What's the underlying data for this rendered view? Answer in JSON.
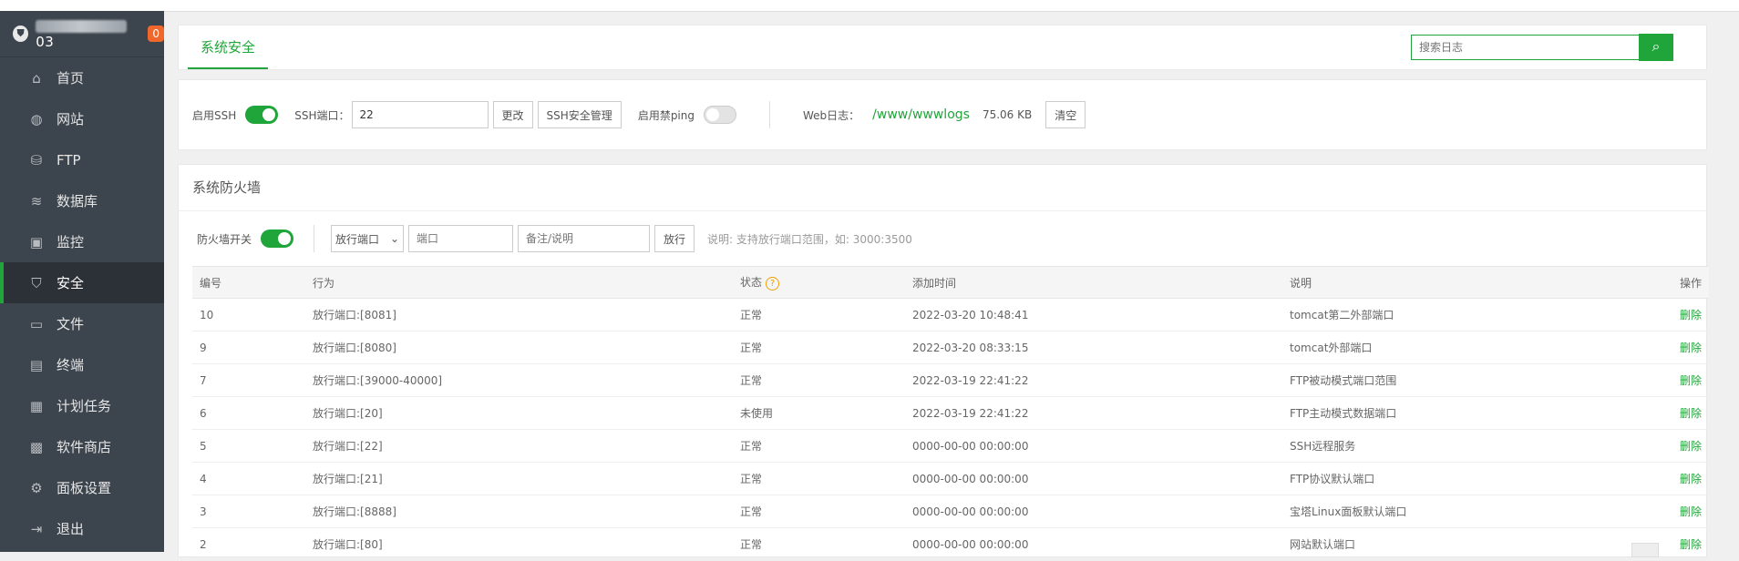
{
  "sidebar": {
    "host_suffix": "03",
    "badge": "0",
    "items": [
      {
        "label": "首页",
        "icon": "home-icon"
      },
      {
        "label": "网站",
        "icon": "globe-icon"
      },
      {
        "label": "FTP",
        "icon": "ftp-icon"
      },
      {
        "label": "数据库",
        "icon": "database-icon"
      },
      {
        "label": "监控",
        "icon": "monitor-icon"
      },
      {
        "label": "安全",
        "icon": "shield-icon",
        "active": true
      },
      {
        "label": "文件",
        "icon": "folder-icon"
      },
      {
        "label": "终端",
        "icon": "terminal-icon"
      },
      {
        "label": "计划任务",
        "icon": "calendar-icon"
      },
      {
        "label": "软件商店",
        "icon": "apps-icon"
      },
      {
        "label": "面板设置",
        "icon": "gear-icon"
      },
      {
        "label": "退出",
        "icon": "logout-icon"
      }
    ]
  },
  "header": {
    "tab": "系统安全",
    "search_placeholder": "搜索日志"
  },
  "settings": {
    "ssh_label": "启用SSH",
    "ssh_port_label": "SSH端口：",
    "ssh_port_value": "22",
    "change_btn": "更改",
    "ssh_manage_btn": "SSH安全管理",
    "ping_label": "启用禁ping",
    "weblog_label": "Web日志：",
    "weblog_path": "/www/wwwlogs",
    "weblog_size": "75.06 KB",
    "clear_btn": "清空"
  },
  "firewall": {
    "title": "系统防火墙",
    "switch_label": "防火墙开关",
    "select_value": "放行端口",
    "port_placeholder": "端口",
    "remark_placeholder": "备注/说明",
    "allow_btn": "放行",
    "hint": "说明: 支持放行端口范围，如: 3000:3500",
    "columns": [
      "编号",
      "行为",
      "状态",
      "添加时间",
      "说明",
      "操作"
    ],
    "rows": [
      {
        "id": "10",
        "action": "放行端口:[8081]",
        "status": "正常",
        "time": "2022-03-20 10:48:41",
        "desc": "tomcat第二外部端口",
        "op": "删除"
      },
      {
        "id": "9",
        "action": "放行端口:[8080]",
        "status": "正常",
        "time": "2022-03-20 08:33:15",
        "desc": "tomcat外部端口",
        "op": "删除"
      },
      {
        "id": "7",
        "action": "放行端口:[39000-40000]",
        "status": "正常",
        "time": "2022-03-19 22:41:22",
        "desc": "FTP被动模式端口范围",
        "op": "删除"
      },
      {
        "id": "6",
        "action": "放行端口:[20]",
        "status": "未使用",
        "time": "2022-03-19 22:41:22",
        "desc": "FTP主动模式数据端口",
        "op": "删除"
      },
      {
        "id": "5",
        "action": "放行端口:[22]",
        "status": "正常",
        "time": "0000-00-00 00:00:00",
        "desc": "SSH远程服务",
        "op": "删除"
      },
      {
        "id": "4",
        "action": "放行端口:[21]",
        "status": "正常",
        "time": "0000-00-00 00:00:00",
        "desc": "FTP协议默认端口",
        "op": "删除"
      },
      {
        "id": "3",
        "action": "放行端口:[8888]",
        "status": "正常",
        "time": "0000-00-00 00:00:00",
        "desc": "宝塔Linux面板默认端口",
        "op": "删除"
      },
      {
        "id": "2",
        "action": "放行端口:[80]",
        "status": "正常",
        "time": "0000-00-00 00:00:00",
        "desc": "网站默认端口",
        "op": "删除"
      }
    ]
  }
}
